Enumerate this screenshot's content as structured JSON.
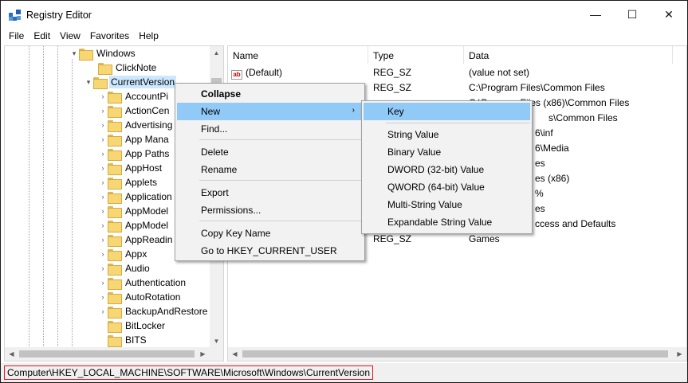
{
  "window": {
    "title": "Registry Editor",
    "controls": {
      "minimize": "—",
      "maximize": "☐",
      "close": "✕"
    }
  },
  "menubar": [
    "File",
    "Edit",
    "View",
    "Favorites",
    "Help"
  ],
  "tree": {
    "windows": "Windows",
    "clicknote": "ClickNote",
    "currentversion": "CurrentVersion",
    "children": [
      "AccountPi",
      "ActionCen",
      "Advertising",
      "App Mana",
      "App Paths",
      "AppHost",
      "Applets",
      "Application",
      "AppModel",
      "AppModel",
      "AppReadin",
      "Appx",
      "Audio",
      "Authentication",
      "AutoRotation",
      "BackupAndRestore",
      "BitLocker",
      "BITS"
    ]
  },
  "list": {
    "headers": {
      "name": "Name",
      "type": "Type",
      "data": "Data"
    },
    "rows": [
      {
        "name": "(Default)",
        "type": "REG_SZ",
        "data": "(value not set)"
      },
      {
        "name": "",
        "type": "REG_SZ",
        "data": "C:\\Program Files\\Common Files"
      },
      {
        "name": "",
        "type": "",
        "data": "C:\\Program Files (x86)\\Common Files"
      },
      {
        "name": "",
        "type": "",
        "data": "s\\Common Files"
      },
      {
        "name": "",
        "type": "",
        "data": "6\\inf"
      },
      {
        "name": "",
        "type": "",
        "data": "6\\Media"
      },
      {
        "name": "",
        "type": "",
        "data": "es"
      },
      {
        "name": "",
        "type": "",
        "data": "es (x86)"
      },
      {
        "name": "",
        "type": "",
        "data": "%"
      },
      {
        "name": "",
        "type": "",
        "data": "es"
      },
      {
        "name": "",
        "type": "",
        "data": "ccess and Defaults"
      },
      {
        "name": "",
        "type": "REG_SZ",
        "data": "Games"
      }
    ]
  },
  "context_menu": {
    "collapse": "Collapse",
    "new": "New",
    "find": "Find...",
    "delete": "Delete",
    "rename": "Rename",
    "export": "Export",
    "permissions": "Permissions...",
    "copy_key_name": "Copy Key Name",
    "goto": "Go to HKEY_CURRENT_USER"
  },
  "new_submenu": {
    "key": "Key",
    "string_value": "String Value",
    "binary_value": "Binary Value",
    "dword_value": "DWORD (32-bit) Value",
    "qword_value": "QWORD (64-bit) Value",
    "multi_string_value": "Multi-String Value",
    "expandable_string_value": "Expandable String Value"
  },
  "statusbar": {
    "path": "Computer\\HKEY_LOCAL_MACHINE\\SOFTWARE\\Microsoft\\Windows\\CurrentVersion"
  },
  "colors": {
    "selection": "#cce8ff",
    "menu_highlight": "#91c9f7",
    "status_outline": "#e81123",
    "folder": "#f7d774"
  },
  "icons": [
    "registry-app-icon",
    "folder-icon",
    "expand-arrow-icon",
    "collapse-arrow-icon",
    "string-value-icon",
    "submenu-arrow-icon"
  ]
}
